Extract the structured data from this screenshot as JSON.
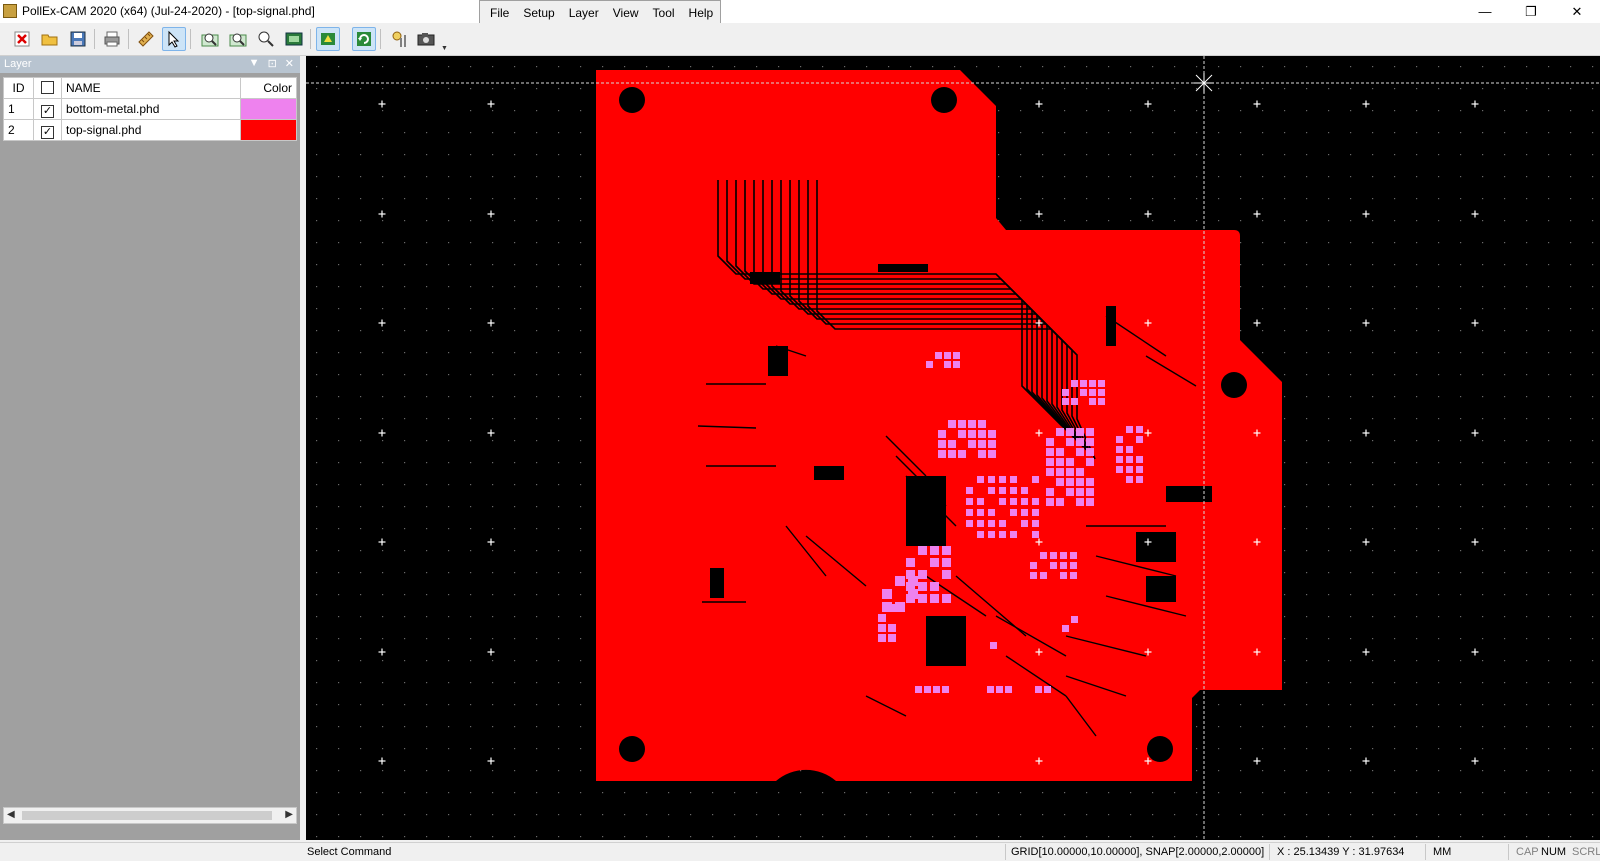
{
  "window": {
    "title": "PollEx-CAM 2020 (x64) (Jul-24-2020) - [top-signal.phd]",
    "controls": {
      "minimize": "—",
      "restore": "❐",
      "close": "✕"
    }
  },
  "menu": {
    "items": [
      "File",
      "Setup",
      "Layer",
      "View",
      "Tool",
      "Help"
    ]
  },
  "toolbar": {
    "buttons": [
      "close-file-icon",
      "open-folder-icon",
      "save-icon",
      "print-icon",
      "ruler-icon",
      "select-arrow-icon",
      "zoom-in-icon",
      "zoom-out-icon",
      "zoom-window-icon",
      "zoom-fit-icon",
      "layer-settings-icon",
      "refresh-icon",
      "options-icon",
      "camera-icon"
    ]
  },
  "layer_panel": {
    "title": "Layer",
    "ctrl_dropdown": "▼",
    "ctrl_pin": "⊡",
    "ctrl_close": "✕",
    "columns": {
      "id": "ID",
      "name": "NAME",
      "color": "Color"
    },
    "rows": [
      {
        "id": "1",
        "checked": "✓",
        "name": "bottom-metal.phd",
        "color": "#ee82ee"
      },
      {
        "id": "2",
        "checked": "✓",
        "name": "top-signal.phd",
        "color": "#ff0000"
      }
    ]
  },
  "status": {
    "command": "Select Command",
    "grid": "GRID[10.00000,10.00000], SNAP[2.00000,2.00000]",
    "coords": "X : 25.13439  Y : 31.97634",
    "unit": "MM",
    "caps": "CAP",
    "num": "NUM",
    "scrl": "SCRL"
  },
  "colors": {
    "board": "#ff0000",
    "pad": "#ee82ee",
    "canvas_bg": "#000000"
  }
}
